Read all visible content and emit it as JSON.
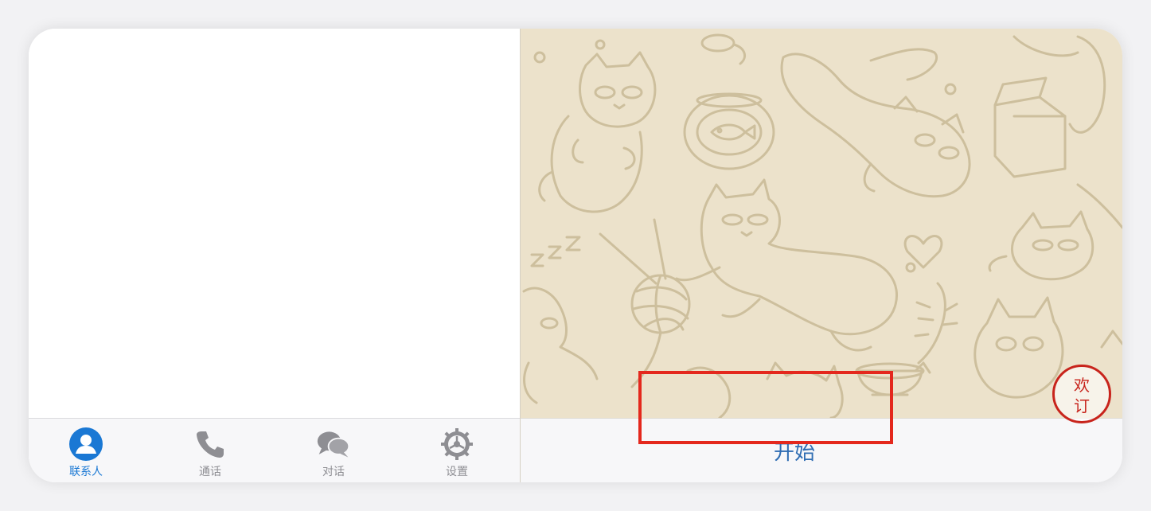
{
  "tabbar": {
    "tabs": [
      {
        "label": "联系人",
        "icon": "contacts-icon",
        "active": true
      },
      {
        "label": "通话",
        "icon": "phone-icon",
        "active": false
      },
      {
        "label": "对话",
        "icon": "chat-bubbles-icon",
        "active": false
      },
      {
        "label": "设置",
        "icon": "gear-icon",
        "active": false
      }
    ]
  },
  "main": {
    "start_label": "开始"
  },
  "seal": {
    "text": "欢订"
  },
  "colors": {
    "accent": "#1a78d4",
    "inactive": "#8e8e93",
    "wallpaper": "#ece2cb",
    "doodle": "#cdbf9d",
    "highlight": "#e4281d"
  }
}
